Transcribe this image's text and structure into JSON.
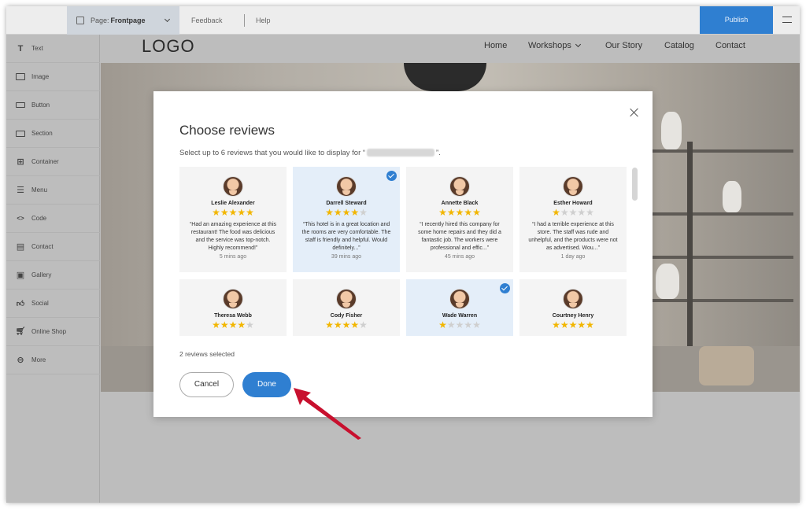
{
  "topbar": {
    "page_prefix": "Page:",
    "page_name": "Frontpage",
    "feedback": "Feedback",
    "help": "Help",
    "publish": "Publish"
  },
  "sidebar": {
    "items": [
      {
        "label": "Text",
        "icon": "text-icon"
      },
      {
        "label": "Image",
        "icon": "image-icon"
      },
      {
        "label": "Button",
        "icon": "button-icon"
      },
      {
        "label": "Section",
        "icon": "section-icon"
      },
      {
        "label": "Container",
        "icon": "container-icon"
      },
      {
        "label": "Menu",
        "icon": "menu-icon"
      },
      {
        "label": "Code",
        "icon": "code-icon"
      },
      {
        "label": "Contact",
        "icon": "contact-icon"
      },
      {
        "label": "Gallery",
        "icon": "gallery-icon"
      },
      {
        "label": "Social",
        "icon": "thumbs-up-icon"
      },
      {
        "label": "Online Shop",
        "icon": "cart-icon"
      },
      {
        "label": "More",
        "icon": "more-icon"
      }
    ]
  },
  "site": {
    "logo": "LOGO",
    "nav": [
      "Home",
      "Workshops",
      "Our Story",
      "Catalog",
      "Contact"
    ]
  },
  "modal": {
    "title": "Choose reviews",
    "subtitle_before": "Select up to 6 reviews that you would like to display for “",
    "subtitle_after": "”.",
    "selected_count": "2 reviews selected",
    "cancel": "Cancel",
    "done": "Done",
    "reviews": [
      {
        "name": "Leslie Alexander",
        "rating": 5,
        "text": "“Had an amazing experience at this restaurant! The food was delicious and the service was top-notch. Highly recommend!”",
        "time": "5 mins ago",
        "selected": false
      },
      {
        "name": "Darrell Steward",
        "rating": 4,
        "text": "“This hotel is in a great location and the rooms are very comfortable. The staff is friendly and helpful. Would definitely...”",
        "time": "39 mins ago",
        "selected": true
      },
      {
        "name": "Annette Black",
        "rating": 5,
        "text": "“I recently hired this company for some home repairs and they did a fantastic job. The workers were professional and effic...”",
        "time": "45 mins ago",
        "selected": false
      },
      {
        "name": "Esther Howard",
        "rating": 1,
        "text": "“I had a terrible experience at this store. The staff was rude and unhelpful, and the products were not as advertised. Wou...”",
        "time": "1 day ago",
        "selected": false
      },
      {
        "name": "Theresa Webb",
        "rating": 4,
        "text": "",
        "time": "",
        "selected": false
      },
      {
        "name": "Cody Fisher",
        "rating": 4,
        "text": "",
        "time": "",
        "selected": false
      },
      {
        "name": "Wade Warren",
        "rating": 1,
        "text": "",
        "time": "",
        "selected": true
      },
      {
        "name": "Courtney Henry",
        "rating": 5,
        "text": "",
        "time": "",
        "selected": false
      }
    ]
  },
  "colors": {
    "accent": "#2f7fd1",
    "star": "#f2b600",
    "selected_card": "#e4eef9",
    "arrow": "#c8102e"
  }
}
